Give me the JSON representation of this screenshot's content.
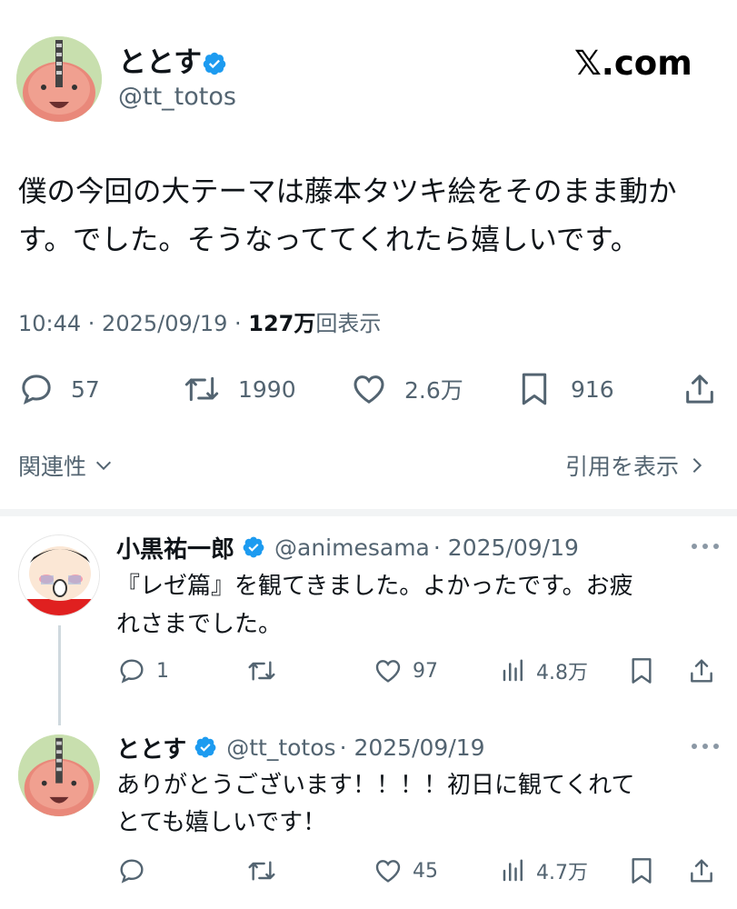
{
  "brand": {
    "logo_text": "𝕏.com"
  },
  "main_post": {
    "author_name": "ととす",
    "handle": "@tt_totos",
    "text_line1": "僕の今回の大テーマは藤本タツキ絵をそのまま動か",
    "text_line2": "す。でした。そうなっててくれたら嬉しいです。",
    "time": "10:44 · 2025/09/19 · ",
    "views_count": "127万",
    "views_label": "回表示",
    "stats": {
      "replies": "57",
      "reposts": "1990",
      "likes": "2.6万",
      "bookmarks": "916"
    }
  },
  "controls": {
    "related_label": "関連性",
    "quotes_label": "引用を表示"
  },
  "replies": [
    {
      "author_name": "小黒祐一郎",
      "handle": "@animesama",
      "date": "· 2025/09/19",
      "text_line1": "『レゼ篇』を観てきました。よかったです。お疲",
      "text_line2": "れさまでした。",
      "replies": "1",
      "reposts": "",
      "likes": "97",
      "views": "4.8万"
    },
    {
      "author_name": "ととす",
      "handle": "@tt_totos",
      "date": "· 2025/09/19",
      "text_line1": "ありがとうございます！！！！初日に観てくれて",
      "text_line2": "とても嬉しいです！",
      "replies": "",
      "reposts": "",
      "likes": "45",
      "views": "4.7万"
    }
  ],
  "colors": {
    "verified": "#1d9bf0",
    "secondary_text": "#536471",
    "text": "#0f1419"
  }
}
